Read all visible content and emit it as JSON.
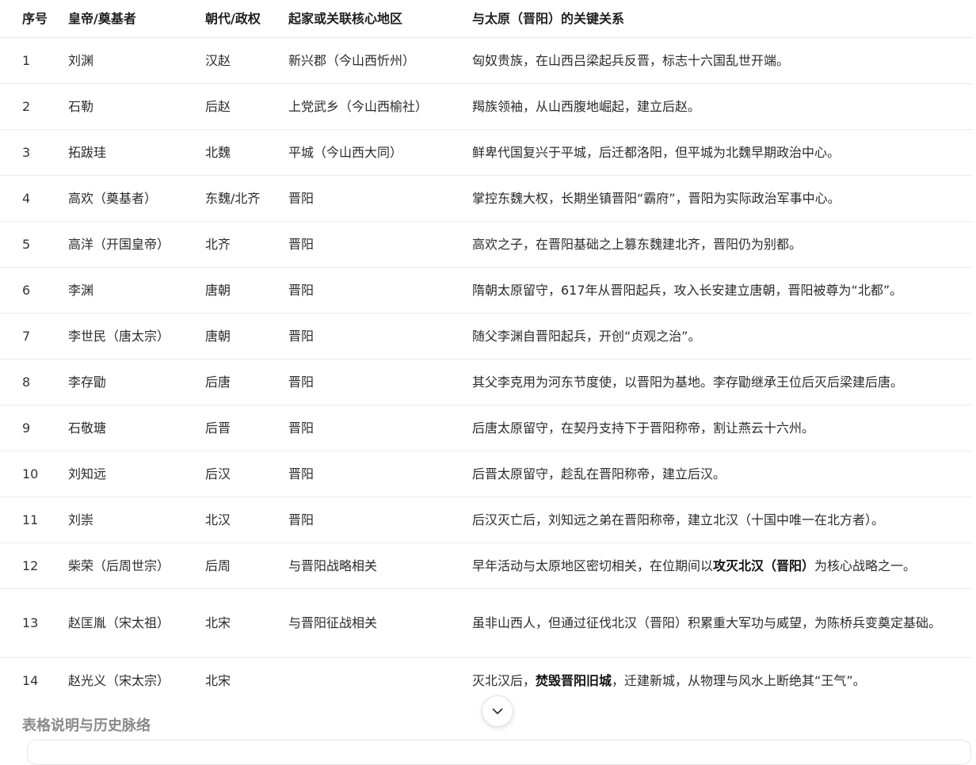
{
  "table": {
    "headers": [
      "序号",
      "皇帝/奠基者",
      "朝代/政权",
      "起家或关联核心地区",
      "与太原（晋阳）的关键关系"
    ],
    "rows": [
      {
        "no": "1",
        "name": "刘渊",
        "dynasty": "汉赵",
        "region": "新兴郡（今山西忻州）",
        "rel_a": "匈奴贵族，在山西吕梁起兵反晋，标志十六国乱世开端。",
        "rel_b": "",
        "rel_c": ""
      },
      {
        "no": "2",
        "name": "石勒",
        "dynasty": "后赵",
        "region": "上党武乡（今山西榆社）",
        "rel_a": "羯族领袖，从山西腹地崛起，建立后赵。",
        "rel_b": "",
        "rel_c": ""
      },
      {
        "no": "3",
        "name": "拓跋珪",
        "dynasty": "北魏",
        "region": "平城（今山西大同）",
        "rel_a": "鲜卑代国复兴于平城，后迁都洛阳，但平城为北魏早期政治中心。",
        "rel_b": "",
        "rel_c": ""
      },
      {
        "no": "4",
        "name": "高欢（奠基者）",
        "dynasty": "东魏/北齐",
        "region": "晋阳",
        "rel_a": "掌控东魏大权，长期坐镇晋阳“霸府”，晋阳为实际政治军事中心。",
        "rel_b": "",
        "rel_c": ""
      },
      {
        "no": "5",
        "name": "高洋（开国皇帝）",
        "dynasty": "北齐",
        "region": "晋阳",
        "rel_a": "高欢之子，在晋阳基础之上篡东魏建北齐，晋阳仍为别都。",
        "rel_b": "",
        "rel_c": ""
      },
      {
        "no": "6",
        "name": "李渊",
        "dynasty": "唐朝",
        "region": "晋阳",
        "rel_a": "隋朝太原留守，617年从晋阳起兵，攻入长安建立唐朝，晋阳被尊为“北都”。",
        "rel_b": "",
        "rel_c": ""
      },
      {
        "no": "7",
        "name": "李世民（唐太宗）",
        "dynasty": "唐朝",
        "region": "晋阳",
        "rel_a": "随父李渊自晋阳起兵，开创“贞观之治”。",
        "rel_b": "",
        "rel_c": ""
      },
      {
        "no": "8",
        "name": "李存勖",
        "dynasty": "后唐",
        "region": "晋阳",
        "rel_a": "其父李克用为河东节度使，以晋阳为基地。李存勖继承王位后灭后梁建后唐。",
        "rel_b": "",
        "rel_c": ""
      },
      {
        "no": "9",
        "name": "石敬瑭",
        "dynasty": "后晋",
        "region": "晋阳",
        "rel_a": "后唐太原留守，在契丹支持下于晋阳称帝，割让燕云十六州。",
        "rel_b": "",
        "rel_c": ""
      },
      {
        "no": "10",
        "name": "刘知远",
        "dynasty": "后汉",
        "region": "晋阳",
        "rel_a": "后晋太原留守，趁乱在晋阳称帝，建立后汉。",
        "rel_b": "",
        "rel_c": ""
      },
      {
        "no": "11",
        "name": "刘崇",
        "dynasty": "北汉",
        "region": "晋阳",
        "rel_a": "后汉灭亡后，刘知远之弟在晋阳称帝，建立北汉（十国中唯一在北方者）。",
        "rel_b": "",
        "rel_c": ""
      },
      {
        "no": "12",
        "name": "柴荣（后周世宗）",
        "dynasty": "后周",
        "region": "与晋阳战略相关",
        "rel_a": "早年活动与太原地区密切相关，在位期间以",
        "rel_b": "攻灭北汉（晋阳）",
        "rel_c": "为核心战略之一。"
      },
      {
        "no": "13",
        "name": "赵匡胤（宋太祖）",
        "dynasty": "北宋",
        "region": "与晋阳征战相关",
        "rel_a": "虽非山西人，但通过征伐北汉（晋阳）积累重大军功与威望，为陈桥兵变奠定基础。",
        "rel_b": "",
        "rel_c": ""
      },
      {
        "no": "14",
        "name": "赵光义（宋太宗）",
        "dynasty": "北宋",
        "region": "",
        "rel_a": "灭北汉后，",
        "rel_b": "焚毁晋阳旧城",
        "rel_c": "，迁建新城，从物理与风水上断绝其“王气”。"
      }
    ]
  },
  "section_title": "表格说明与历史脉络",
  "icons": {
    "scroll_down": "chevron-down-icon"
  },
  "colors": {
    "text": "#2b2b2b",
    "header_text": "#1f1f1f",
    "row_border": "#ececec",
    "section_title": "#8a8a8a"
  }
}
